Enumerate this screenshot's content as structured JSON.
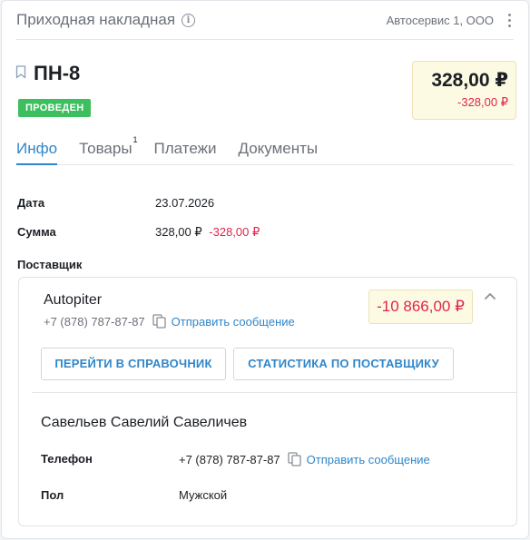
{
  "header": {
    "title": "Приходная накладная",
    "company": "Автосервис 1, ООО"
  },
  "document": {
    "number": "ПН-8",
    "status": "ПРОВЕДЕН",
    "amount": "328,00 ₽",
    "amount_diff": "-328,00 ₽"
  },
  "tabs": [
    {
      "label": "Инфо",
      "active": true
    },
    {
      "label": "Товары",
      "badge": "1"
    },
    {
      "label": "Платежи"
    },
    {
      "label": "Документы"
    }
  ],
  "info": {
    "date_label": "Дата",
    "date_value": "23.07.2026",
    "sum_label": "Сумма",
    "sum_value": "328,00 ₽",
    "sum_diff": "-328,00 ₽",
    "supplier_label": "Поставщик"
  },
  "supplier": {
    "name": "Autopiter",
    "phone": "+7 (878) 787-87-87",
    "message_link": "Отправить сообщение",
    "balance": "-10 866,00 ₽",
    "directory_button": "ПЕРЕЙТИ В СПРАВОЧНИК",
    "stats_button": "СТАТИСТИКА ПО ПОСТАВЩИКУ"
  },
  "contact": {
    "name": "Савельев Савелий Савеличев",
    "phone_label": "Телефон",
    "phone": "+7 (878) 787-87-87",
    "message_link": "Отправить сообщение",
    "gender_label": "Пол",
    "gender": "Мужской"
  },
  "colors": {
    "accent": "#2f86c9",
    "negative": "#e0254a",
    "status": "#3dbe5f",
    "highlight_bg": "#fdfae3"
  }
}
